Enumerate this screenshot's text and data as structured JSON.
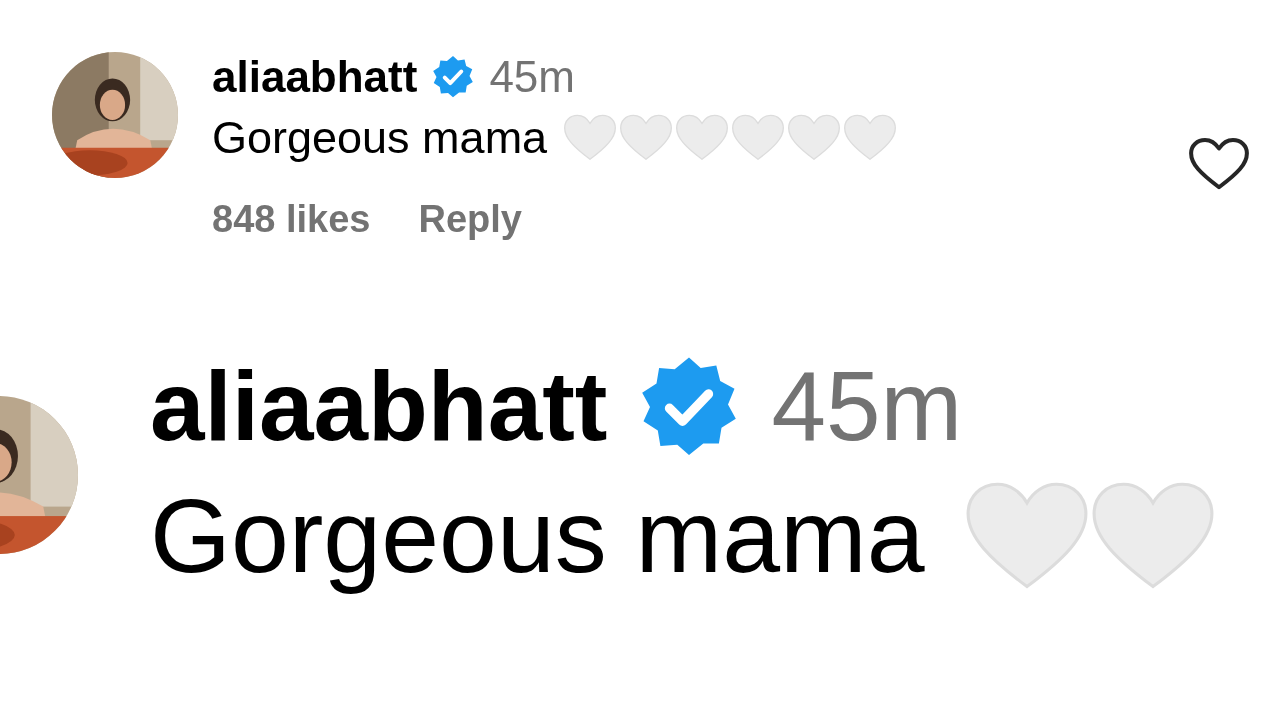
{
  "comment": {
    "username": "aliaabhatt",
    "verified": true,
    "time": "45m",
    "text": "Gorgeous mama",
    "likes": "848 likes",
    "reply": "Reply",
    "liked": false
  },
  "zoomed": {
    "username": "aliaabhatt",
    "verified": true,
    "time": "45m",
    "text": "Gorgeous mama"
  }
}
